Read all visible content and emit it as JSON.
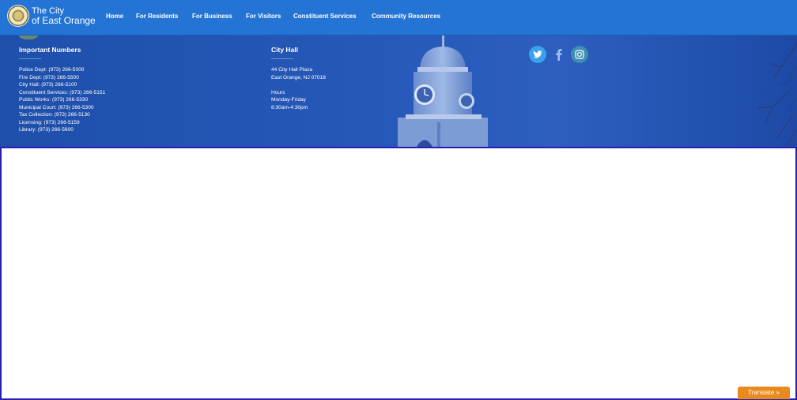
{
  "brand": {
    "line1": "The City",
    "line2": "of East Orange"
  },
  "nav": [
    "Home",
    "For Residents",
    "For Business",
    "For Visitors",
    "Constituent Services",
    "Community Resources"
  ],
  "important_numbers": {
    "title": "Important Numbers",
    "separator": "-----------------",
    "lines": [
      "Police Dept: (973) 266-5000",
      "Fire Dept: (973) 266-5500",
      "City Hall: (973) 266-5100",
      "Constituent Services: (973) 266-5151",
      "Public Works: (973) 266-5330",
      "Municipal Court: (973) 266-5300",
      "Tax Collection: (973) 266-5130",
      "Licensing: (973) 266-5159",
      "Library: (973) 266-5600"
    ]
  },
  "city_hall": {
    "title": "City Hall",
    "separator": "-----------------",
    "lines": [
      "44 City Hall Plaza",
      "East Orange, NJ 07018",
      "",
      "Hours",
      "Monday-Friday",
      "8:30am-4:30pm"
    ]
  },
  "social": [
    {
      "name": "twitter-icon"
    },
    {
      "name": "facebook-icon"
    },
    {
      "name": "instagram-icon"
    }
  ],
  "translate": {
    "label": "Translate »"
  },
  "colors": {
    "header": "#2374d4",
    "band": "#2558b8",
    "frame_border": "#2a1fb5",
    "translate_bg": "#e88a1c"
  }
}
